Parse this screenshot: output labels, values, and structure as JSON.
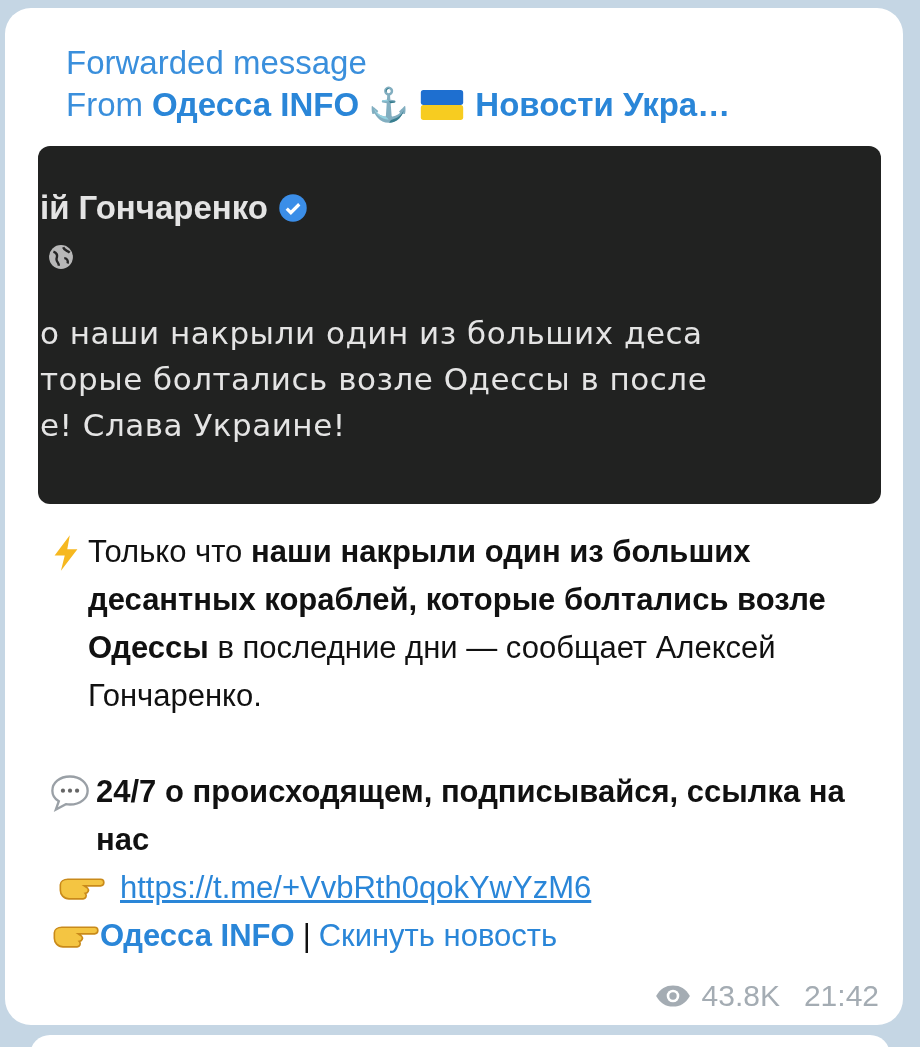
{
  "forward": {
    "title": "Forwarded message",
    "prefix": "From",
    "channel_part_1": "Одесса INFO ⚓",
    "channel_part_2": "Новости Укра…"
  },
  "screenshot": {
    "author": "ій Гончаренко",
    "verified": true,
    "lines": [
      "о наши накрыли один из больших деса",
      "торые болтались возле Одессы в после",
      "е! Слава Украине!"
    ]
  },
  "text": "Только что **наши накрыли один из больших десантных кораблей, которые болтались возле Одессы** в последние дни — сообщает Алексей Гончаренко.",
  "promo": "24/7 о происходящем, подписывайся, ссылка на нас",
  "link": "https://t.me/+VvbRth0qokYwYzM6",
  "footer_links": [
    {
      "label": "Одесса INFO",
      "bold": true
    },
    {
      "label": "Скинуть новость",
      "bold": false
    }
  ],
  "separator": "|",
  "views": "43.8K",
  "time": "21:42"
}
